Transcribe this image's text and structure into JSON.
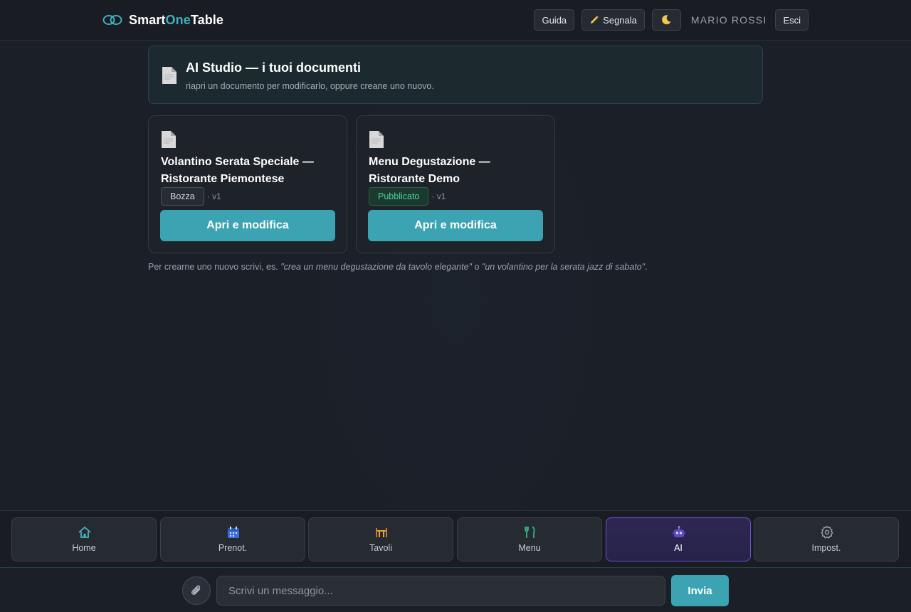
{
  "app": {
    "brand_part1": "Smart",
    "brand_part2": "One",
    "brand_part3": "Table",
    "logo_icon": "linked-rings-logo",
    "accent_color": "#3fb0c2"
  },
  "topbar": {
    "guide_label": "Guida",
    "report_label": "Segnala",
    "report_icon": "pencil-icon",
    "theme_icon": "moon-icon",
    "user_name": "MARIO ROSSI",
    "logout_label": "Esci"
  },
  "header": {
    "icon": "document-icon",
    "title": "AI Studio — i tuoi documenti",
    "subtitle": "riapri un documento per modificarlo, oppure creane uno nuovo."
  },
  "documents": [
    {
      "icon": "document-icon",
      "title": "Volantino Serata Speciale — Ristorante Piemontese",
      "status": "Bozza",
      "version": "· v1",
      "action_label": "Apri e modifica"
    },
    {
      "icon": "document-icon",
      "title": "Menu Degustazione — Ristorante Demo",
      "status": "Pubblicato",
      "version": "· v1",
      "action_label": "Apri e modifica"
    }
  ],
  "hint": {
    "prefix": "Per crearne uno nuovo scrivi, es. ",
    "example1": "\"crea un menu degustazione da tavolo elegante\"",
    "connector": " o ",
    "example2": "\"un volantino per la serata jazz di sabato\"",
    "suffix": "."
  },
  "bottom_nav": [
    {
      "label": "Home",
      "icon": "home-icon"
    },
    {
      "label": "Prenot.",
      "icon": "calendar-icon"
    },
    {
      "label": "Tavoli",
      "icon": "table-chairs-icon"
    },
    {
      "label": "Menu",
      "icon": "fork-knife-icon"
    },
    {
      "label": "AI",
      "icon": "robot-icon",
      "active": true
    },
    {
      "label": "Impost.",
      "icon": "gear-icon"
    }
  ],
  "chat": {
    "attach_icon": "paperclip-icon",
    "placeholder": "Scrivi un messaggio...",
    "value": "",
    "send_label": "Invia"
  },
  "colors": {
    "primary_button": "#3ba3b2",
    "published": "#4fd29a",
    "active_nav_border": "#6c4fd0"
  }
}
